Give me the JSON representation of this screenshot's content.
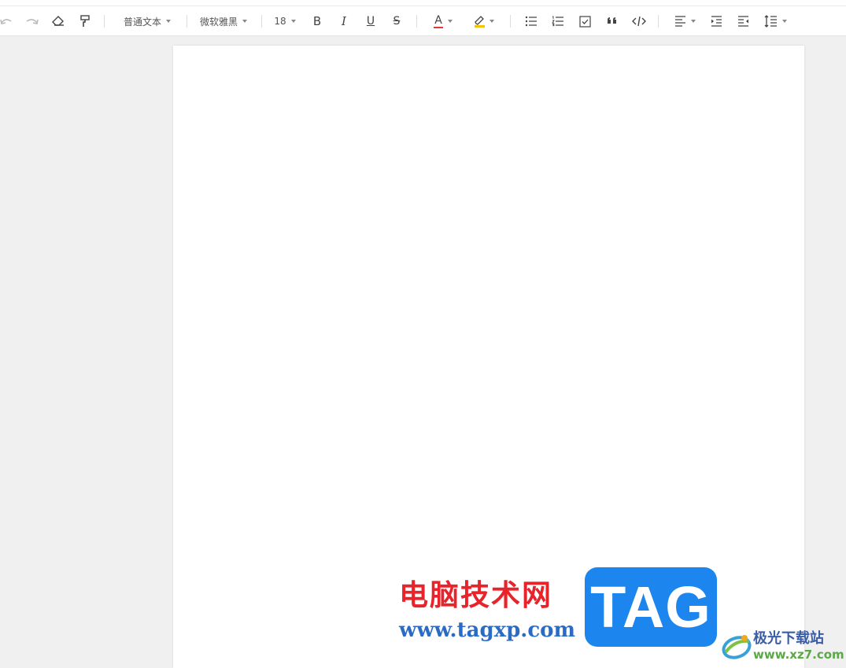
{
  "toolbar": {
    "paragraph_style": "普通文本",
    "font_family": "微软雅黑",
    "font_size": "18",
    "bold_label": "B",
    "italic_label": "I",
    "underline_label": "U",
    "strikethrough_label": "S",
    "font_color_label": "A",
    "font_color": "#e53935",
    "highlight_color": "#f5c400",
    "icons": [
      "undo-icon",
      "redo-icon",
      "eraser-icon",
      "format-painter-icon",
      "bulleted-list-icon",
      "numbered-list-icon",
      "checkbox-list-icon",
      "quote-icon",
      "code-icon",
      "align-left-icon",
      "indent-increase-icon",
      "indent-decrease-icon",
      "line-height-icon"
    ]
  },
  "watermark": {
    "site_name_cn": "电脑技术网",
    "site_url": "www.tagxp.com",
    "tag_logo": "TAG",
    "secondary_site_cn": "极光下载站",
    "secondary_site_url": "www.xz7.com"
  }
}
